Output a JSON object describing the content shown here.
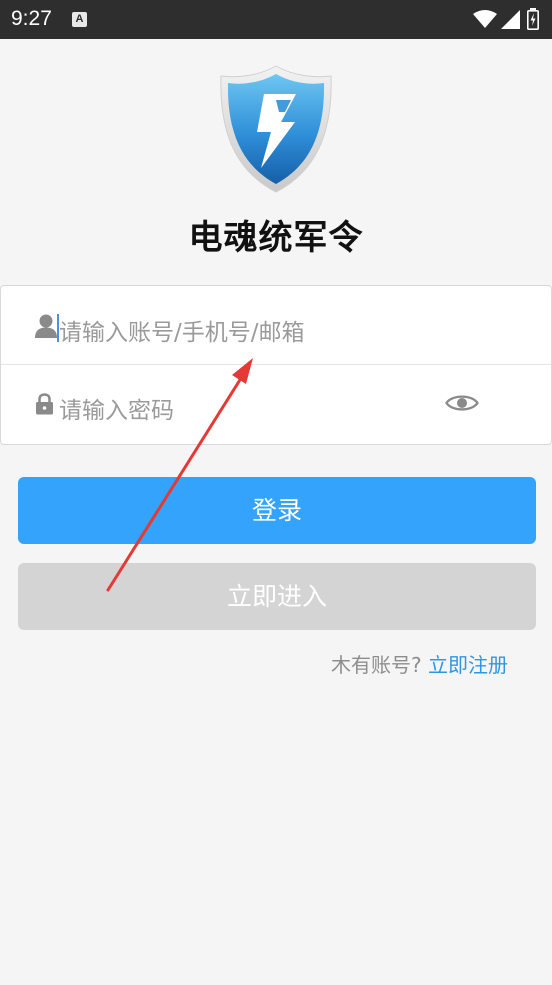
{
  "status_bar": {
    "time": "9:27",
    "notification_icon_letter": "A",
    "icons": [
      "a-notification-icon",
      "wifi-icon",
      "signal-icon",
      "battery-charging-icon"
    ]
  },
  "app": {
    "title": "电魂统军令",
    "logo_icon": "shield-lightning-icon",
    "brand_color": "#2f8fd8"
  },
  "form": {
    "account_placeholder": "请输入账号/手机号/邮箱",
    "password_placeholder": "请输入密码",
    "account_icon": "user-icon",
    "password_icon": "lock-icon",
    "toggle_visibility_icon": "eye-icon"
  },
  "buttons": {
    "login_label": "登录",
    "login_color": "#33a3fb",
    "enter_label": "立即进入",
    "enter_color": "#d4d4d4"
  },
  "register": {
    "prompt": "木有账号?",
    "link_label": "立即注册",
    "link_color": "#2d97e6"
  },
  "annotation": {
    "type": "red-arrow",
    "color": "#e53935",
    "points_to": "account-input"
  }
}
